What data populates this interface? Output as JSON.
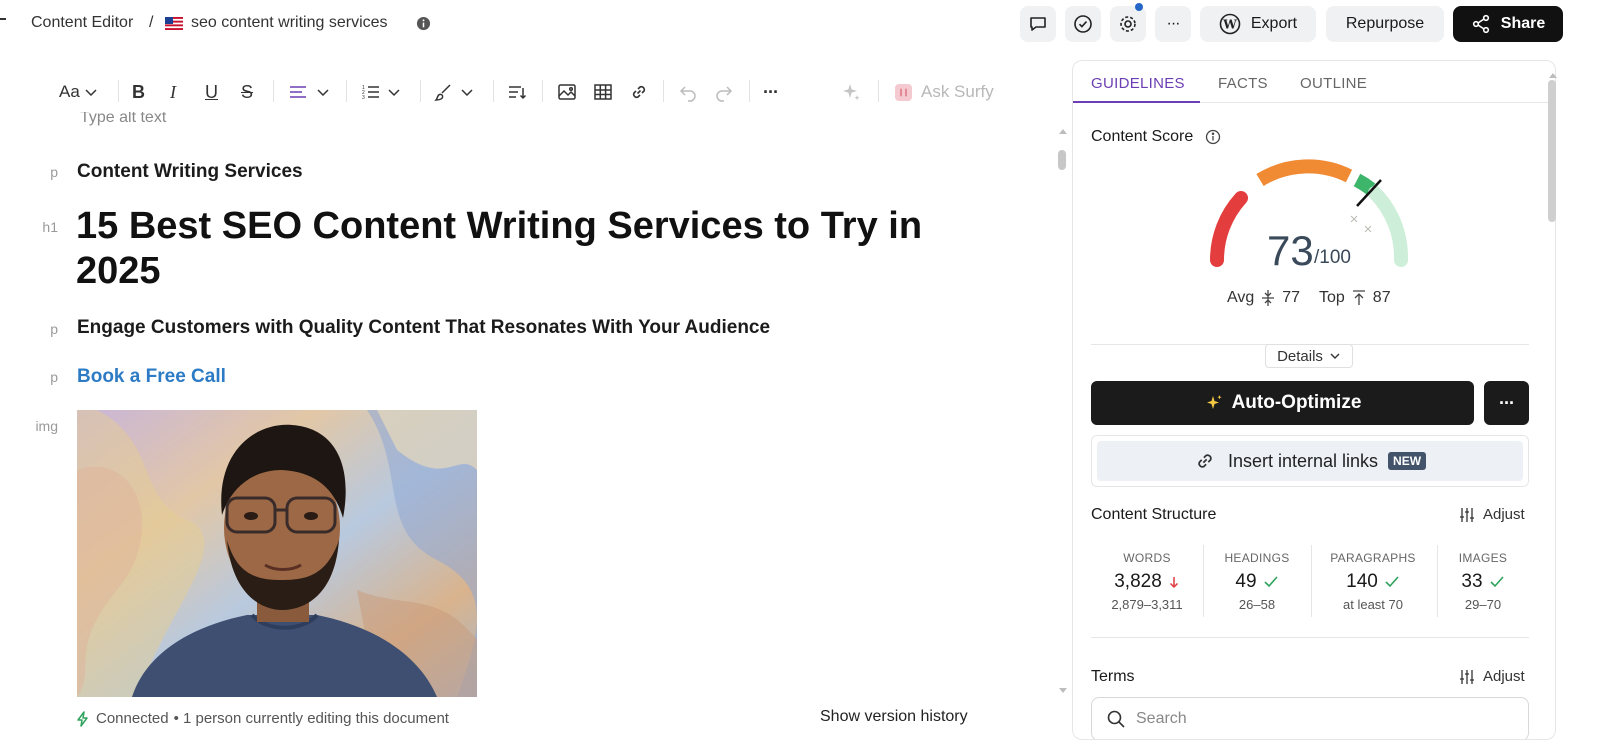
{
  "breadcrumb": {
    "root": "Content Editor",
    "separator": "/",
    "flag": "us-flag",
    "document": "seo content writing services"
  },
  "header": {
    "export_label": "Export",
    "repurpose_label": "Repurpose",
    "share_label": "Share",
    "more_label": "···"
  },
  "toolbar": {
    "font_label": "Aa",
    "ask_label": "Ask Surfy"
  },
  "editor": {
    "alt_text": "Type alt text",
    "tags": {
      "p": "p",
      "h1": "h1",
      "img": "img"
    },
    "paragraph1": "Content Writing Services",
    "heading": "15 Best SEO Content Writing Services to Try in 2025",
    "paragraph2": "Engage Customers with Quality Content That Resonates With Your Audience",
    "cta_link": "Book a Free Call"
  },
  "status": {
    "connected": "Connected",
    "editing": "• 1 person currently editing this document",
    "history": "Show version history"
  },
  "panel": {
    "tabs": [
      {
        "label": "GUIDELINES",
        "active": true
      },
      {
        "label": "FACTS",
        "active": false
      },
      {
        "label": "OUTLINE",
        "active": false
      }
    ],
    "score": {
      "title": "Content Score",
      "value": "73",
      "max": "/100",
      "fraction": 0.73,
      "avg_label": "Avg",
      "avg_value": "77",
      "top_label": "Top",
      "top_value": "87"
    },
    "details_label": "Details",
    "auto_optimize_label": "Auto-Optimize",
    "insert_links_label": "Insert internal links",
    "new_badge": "NEW",
    "structure": {
      "title": "Content Structure",
      "adjust_label": "Adjust",
      "stats": [
        {
          "label": "WORDS",
          "value": "3,828",
          "status": "down",
          "range": "2,879–3,311"
        },
        {
          "label": "HEADINGS",
          "value": "49",
          "status": "ok",
          "range": "26–58"
        },
        {
          "label": "PARAGRAPHS",
          "value": "140",
          "status": "ok",
          "range": "at least 70"
        },
        {
          "label": "IMAGES",
          "value": "33",
          "status": "ok",
          "range": "29–70"
        }
      ]
    },
    "terms": {
      "title": "Terms",
      "adjust_label": "Adjust",
      "search_placeholder": "Search"
    }
  },
  "colors": {
    "accent_purple": "#6b3fb3",
    "link_blue": "#2d7bc5",
    "gauge_red": "#e43d3d",
    "gauge_orange": "#f08a33",
    "gauge_green": "#3db56a",
    "gauge_light_green": "#cdeed8",
    "ok_green": "#2fa35d",
    "down_red": "#e0393e"
  }
}
